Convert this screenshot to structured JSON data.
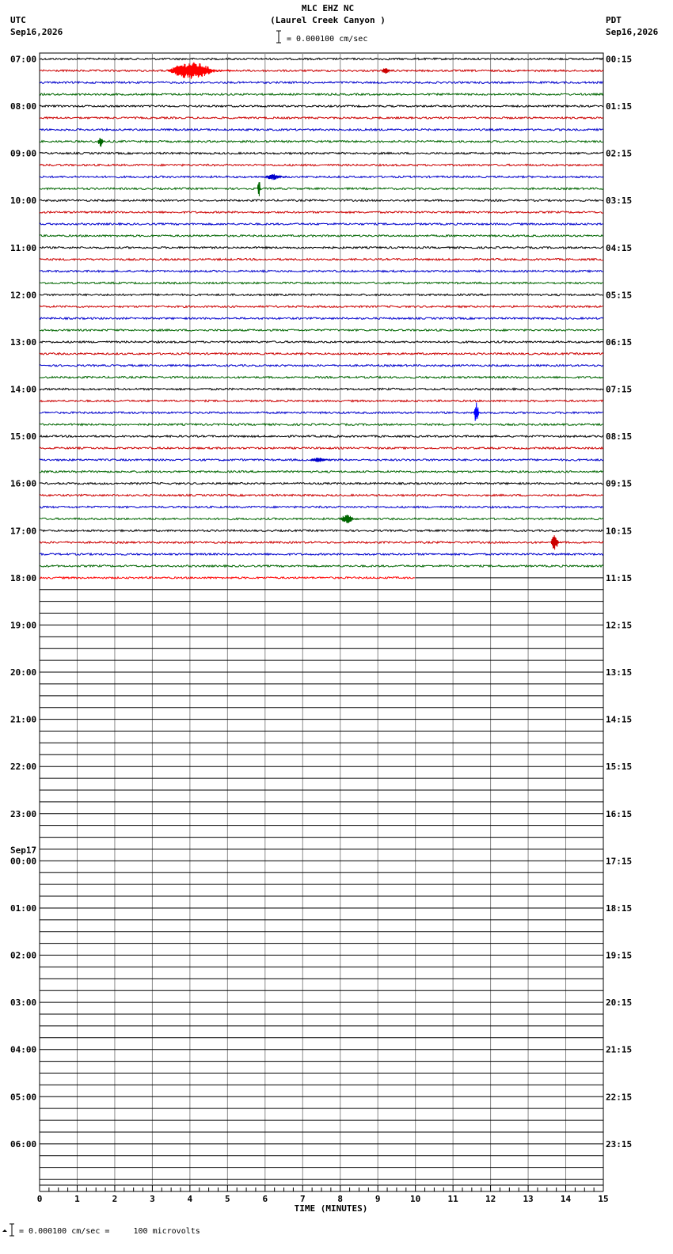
{
  "header": {
    "station": "MLC EHZ NC",
    "location": "(Laurel Creek Canyon )",
    "scale": "= 0.000100 cm/sec",
    "left_tz": "UTC",
    "left_date": "Sep16,2026",
    "right_tz": "PDT",
    "right_date": "Sep16,2026"
  },
  "footer": {
    "scale_note": "= 0.000100 cm/sec =     100 microvolts"
  },
  "chart_data": {
    "type": "line",
    "title": "MLC EHZ NC (Laurel Creek Canyon )",
    "xlabel": "TIME (MINUTES)",
    "x_range": [
      0,
      15
    ],
    "x_ticks": [
      "0",
      "1",
      "2",
      "3",
      "4",
      "5",
      "6",
      "7",
      "8",
      "9",
      "10",
      "11",
      "12",
      "13",
      "14",
      "15"
    ],
    "traces_per_hour": 4,
    "trace_colors": [
      "#000000",
      "#cc0000",
      "#0000cc",
      "#006600"
    ],
    "active_trace_color": "#ff0000",
    "total_traces": 96,
    "filled_traces": 45,
    "partial_trace_minutes": 10,
    "left_labels": [
      "07:00",
      "08:00",
      "09:00",
      "10:00",
      "11:00",
      "12:00",
      "13:00",
      "14:00",
      "15:00",
      "16:00",
      "17:00",
      "18:00",
      "19:00",
      "20:00",
      "21:00",
      "22:00",
      "23:00",
      "00:00",
      "01:00",
      "02:00",
      "03:00",
      "04:00",
      "05:00",
      "06:00"
    ],
    "date_change_label": "Sep17",
    "date_change_index": 17,
    "right_labels": [
      "00:15",
      "01:15",
      "02:15",
      "03:15",
      "04:15",
      "05:15",
      "06:15",
      "07:15",
      "08:15",
      "09:15",
      "10:15",
      "11:15",
      "12:15",
      "13:15",
      "14:15",
      "15:15",
      "16:15",
      "17:15",
      "18:15",
      "19:15",
      "20:15",
      "21:15",
      "22:15",
      "23:15"
    ],
    "events": [
      {
        "trace": 1,
        "start_min": 3.4,
        "end_min": 5.2,
        "amp": 11,
        "color": "#ff0000"
      },
      {
        "trace": 1,
        "start_min": 9.1,
        "end_min": 9.4,
        "amp": 4,
        "color": "#cc0000"
      },
      {
        "trace": 7,
        "start_min": 1.55,
        "end_min": 1.75,
        "amp": 7,
        "color": "#006600"
      },
      {
        "trace": 10,
        "start_min": 6.0,
        "end_min": 6.6,
        "amp": 4,
        "color": "#0000cc"
      },
      {
        "trace": 11,
        "start_min": 5.8,
        "end_min": 5.9,
        "amp": 14,
        "color": "#006600"
      },
      {
        "trace": 30,
        "start_min": 11.55,
        "end_min": 11.75,
        "amp": 13,
        "color": "#0000ff"
      },
      {
        "trace": 34,
        "start_min": 7.2,
        "end_min": 7.8,
        "amp": 3,
        "color": "#0000cc"
      },
      {
        "trace": 39,
        "start_min": 8.0,
        "end_min": 8.5,
        "amp": 6,
        "color": "#006600"
      },
      {
        "trace": 41,
        "start_min": 13.6,
        "end_min": 13.9,
        "amp": 10,
        "color": "#cc0000"
      }
    ]
  }
}
